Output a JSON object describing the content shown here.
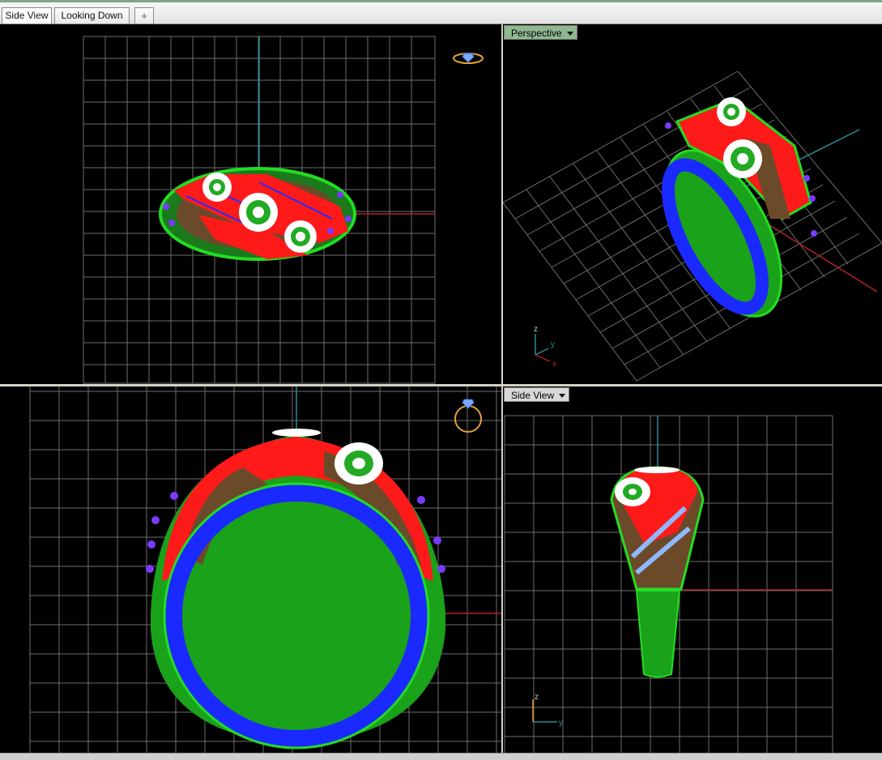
{
  "tabs": [
    {
      "label": "Side View"
    },
    {
      "label": "Looking Down"
    }
  ],
  "add_tab_symbol": "+",
  "viewports": {
    "top_right": {
      "label": "Perspective"
    },
    "bottom_right": {
      "label": "Side View"
    }
  },
  "axes": {
    "x": "x",
    "y": "y",
    "z": "z"
  },
  "colors": {
    "viewport_bg": "#000000",
    "grid": "#7a7a7a",
    "x_axis": "#b22222",
    "z_axis": "#2a8a9a",
    "ring_red": "#ff1a1a",
    "ring_green": "#22dd22",
    "ring_blue": "#1a2aff",
    "gold": "#d9932a",
    "label_green": "#8fb88f"
  }
}
